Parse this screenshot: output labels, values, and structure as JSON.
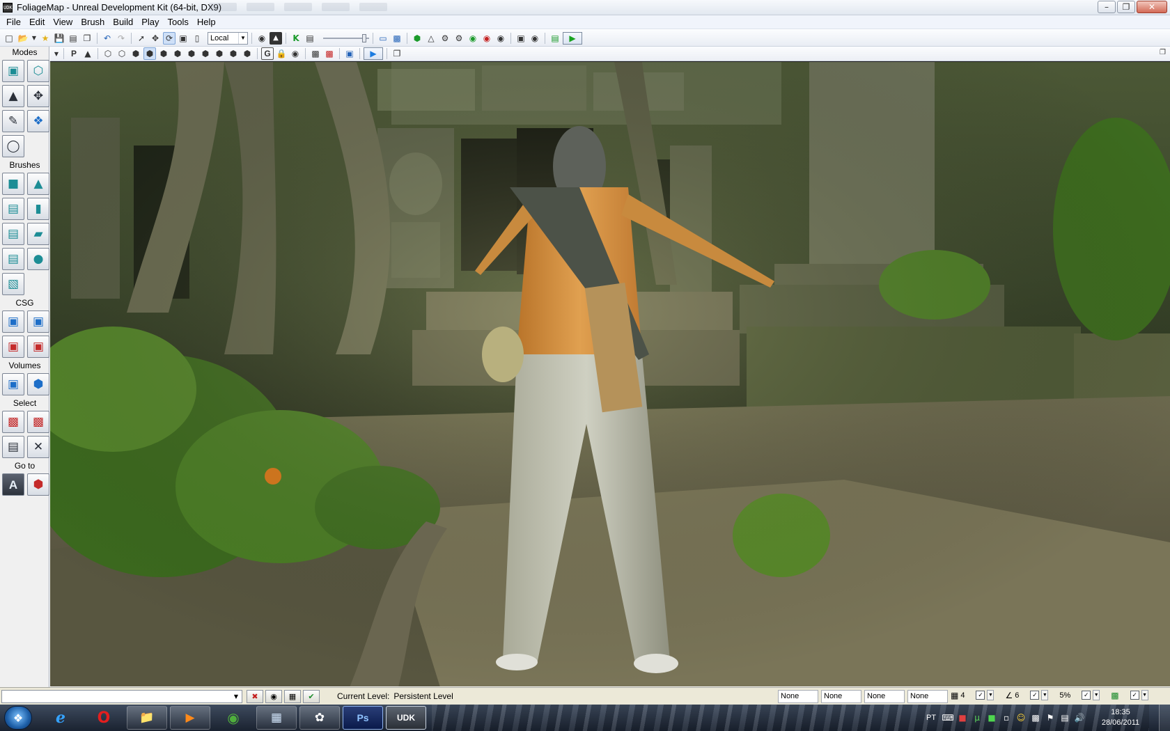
{
  "window": {
    "title": "FoliageMap - Unreal Development Kit (64-bit, DX9)",
    "app_icon": "UDK",
    "minimize_icon": "minimize-icon",
    "maximize_icon": "maximize-icon",
    "close_icon": "close-icon"
  },
  "menu": [
    "File",
    "Edit",
    "View",
    "Brush",
    "Build",
    "Play",
    "Tools",
    "Help"
  ],
  "toolbar": {
    "coordinate_system": "Local"
  },
  "left_panel": {
    "modes_label": "Modes",
    "brushes_label": "Brushes",
    "csg_label": "CSG",
    "volumes_label": "Volumes",
    "select_label": "Select",
    "goto_label": "Go to",
    "goto_a_label": "A"
  },
  "toolbar2": {
    "p_label": "P",
    "g_label": "G"
  },
  "statusbar": {
    "command_placeholder": "",
    "current_level_label": "Current Level:",
    "current_level_value": "Persistent Level",
    "drag_fields": [
      "None",
      "None",
      "None",
      "None"
    ],
    "grid_size": "4",
    "rotation_snap": "6",
    "scale_snap": "5%"
  },
  "taskbar": {
    "language": "PT",
    "time": "18:35",
    "date": "28/06/2011",
    "ps_label": "Ps",
    "udk_label": "UDK"
  }
}
